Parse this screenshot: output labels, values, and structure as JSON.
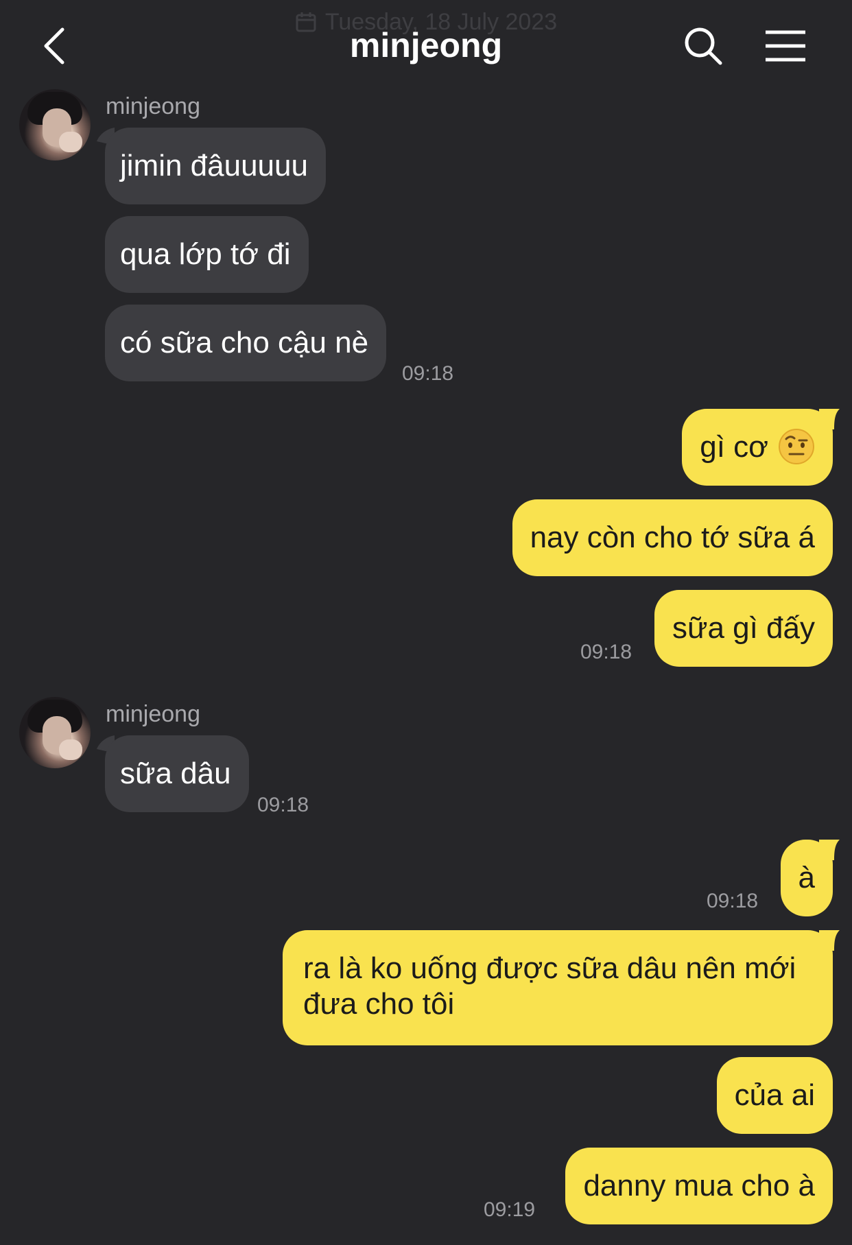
{
  "header": {
    "date_separator": "Tuesday, 18 July 2023",
    "title": "minjeong"
  },
  "groups": [
    {
      "sender": "minjeong",
      "time": "09:18",
      "messages": [
        "jimin đâuuuuu",
        "qua lớp tớ đi",
        "có sữa cho cậu nè"
      ]
    },
    {
      "time": "09:18",
      "messages": [
        "gì cơ",
        "nay còn cho tớ sữa á",
        "sữa gì đấy"
      ],
      "emoji": "raised-eyebrow-face-emoji"
    },
    {
      "sender": "minjeong",
      "time": "09:18",
      "messages": [
        "sữa dâu"
      ]
    },
    {
      "time": "09:18",
      "messages": [
        "à"
      ]
    },
    {
      "time": "09:19",
      "messages": [
        "ra là ko uống được sữa dâu nên mới đưa cho tôi",
        "của ai",
        "danny mua cho à"
      ]
    }
  ],
  "colors": {
    "background": "#262629",
    "incoming_bubble": "#3d3d41",
    "outgoing_bubble": "#f9e24f"
  }
}
